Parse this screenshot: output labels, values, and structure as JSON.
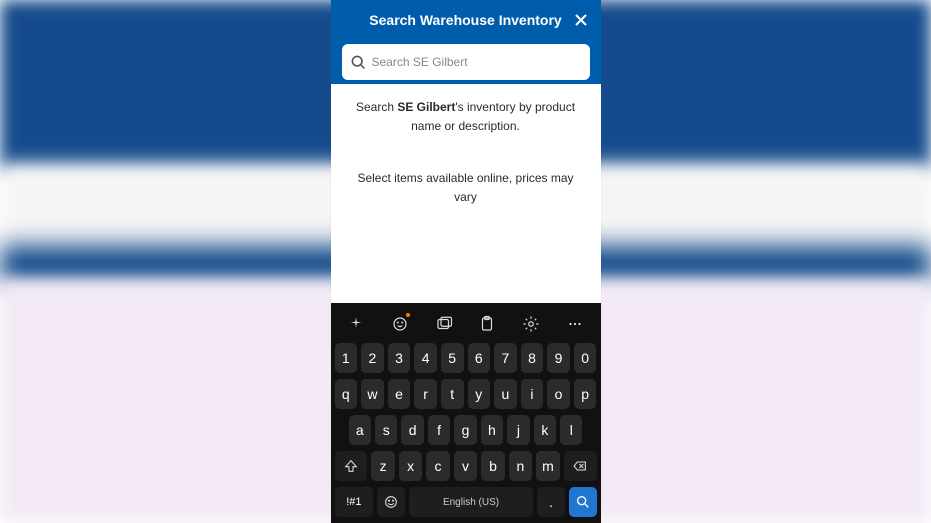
{
  "header": {
    "title": "Search Warehouse Inventory"
  },
  "search": {
    "placeholder": "Search SE Gilbert"
  },
  "content": {
    "info_prefix": "Search ",
    "warehouse_name": "SE Gilbert",
    "info_suffix": "'s inventory by product name or description.",
    "disclaimer": "Select items available online, prices may vary"
  },
  "keyboard": {
    "row_numbers": [
      "1",
      "2",
      "3",
      "4",
      "5",
      "6",
      "7",
      "8",
      "9",
      "0"
    ],
    "row_top": [
      "q",
      "w",
      "e",
      "r",
      "t",
      "y",
      "u",
      "i",
      "o",
      "p"
    ],
    "row_home": [
      "a",
      "s",
      "d",
      "f",
      "g",
      "h",
      "j",
      "k",
      "l"
    ],
    "row_bottom": [
      "z",
      "x",
      "c",
      "v",
      "b",
      "n",
      "m"
    ],
    "sym_label": "!#1",
    "space_label": "English (US)",
    "period_label": "."
  }
}
